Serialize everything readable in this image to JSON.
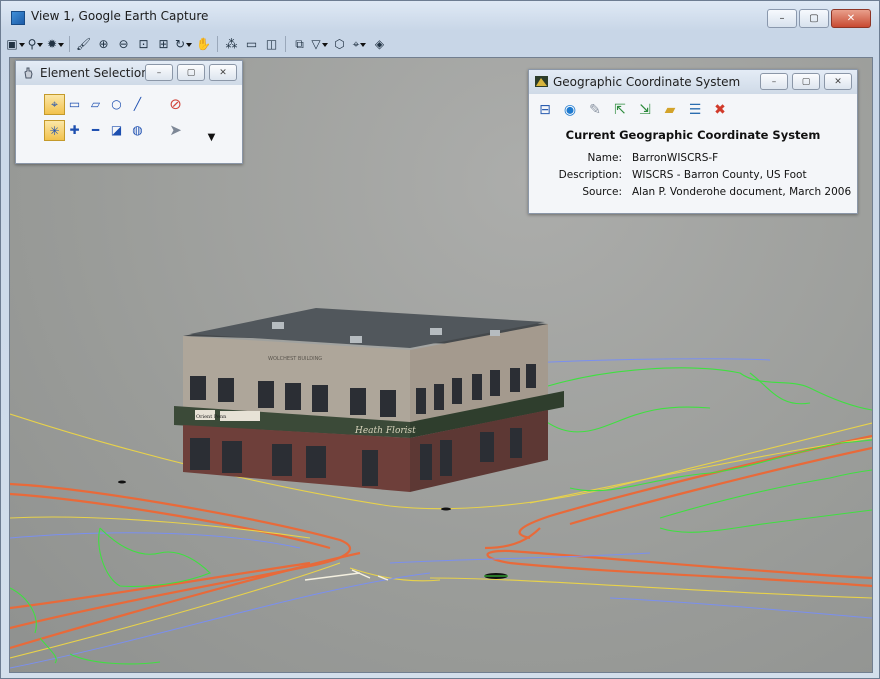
{
  "window": {
    "title": "View 1, Google Earth Capture",
    "controls": [
      "–",
      "▢",
      "✕"
    ]
  },
  "toolbar": {
    "icons": [
      "view-settings-icon",
      "zoom-dropdown-icon",
      "view-attributes-icon",
      "brush-icon",
      "zoom-in-icon",
      "zoom-out-icon",
      "zoom-area-icon",
      "fit-view-icon",
      "rotate-icon",
      "pan-icon",
      "walk-icon",
      "window-area-icon",
      "previous-view-icon",
      "camera-icon",
      "display-style-icon",
      "view-3d-icon",
      "locate-icon",
      "render-icon"
    ]
  },
  "element_selection": {
    "title": "Element Selection",
    "controls": [
      "–",
      "▢",
      "✕"
    ],
    "tools_row1": [
      "individual",
      "block",
      "shape",
      "circle",
      "line"
    ],
    "tools_row2": [
      "sparkle",
      "add",
      "subtract",
      "invert",
      "globe"
    ]
  },
  "gcs": {
    "title": "Geographic Coordinate System",
    "controls": [
      "–",
      "▢",
      "✕"
    ],
    "icons": [
      "select-coordinate-icon",
      "globe-geo-icon",
      "pin-icon",
      "export-icon",
      "import-icon",
      "folder-open-icon",
      "list-icon",
      "delete-icon"
    ],
    "heading": "Current Geographic Coordinate System",
    "labels": {
      "name": "Name:",
      "description": "Description:",
      "source": "Source:"
    },
    "values": {
      "name": "BarronWISCRS-F",
      "description": "WISCRS - Barron County, US Foot",
      "source": "Alan P. Vonderohe document, March 2006"
    }
  },
  "building": {
    "cornice_label": "WOLCHEST BUILDING",
    "sign_left": "Orient Penn",
    "sign_right": "Heath Florist"
  },
  "colors": {
    "viewport": "#9c9d9a",
    "street": "#e86a3a",
    "parcel": "#e8d24a",
    "grass": "#3fe040",
    "accent": "#f2c24e"
  }
}
